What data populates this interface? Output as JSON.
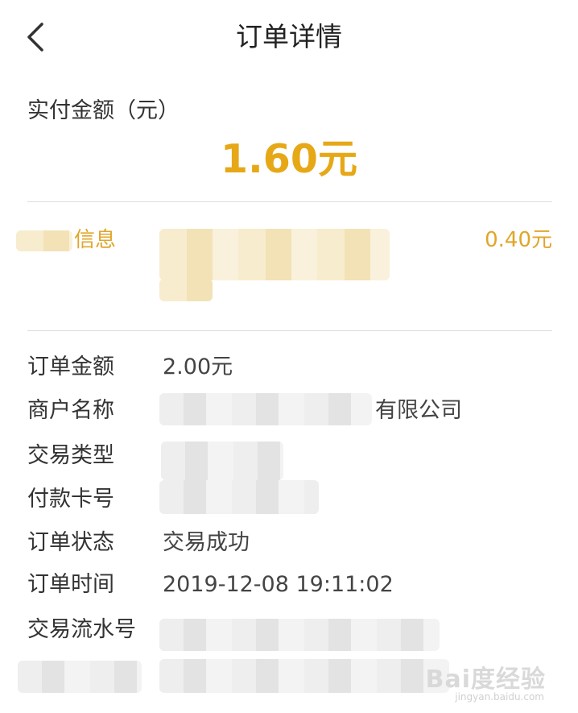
{
  "header": {
    "title": "订单详情"
  },
  "payment": {
    "label": "实付金额（元）",
    "amount": "1.60元"
  },
  "discount": {
    "label": "信息",
    "value": "0.40元"
  },
  "details": {
    "order_amount": {
      "label": "订单金额",
      "value": "2.00元"
    },
    "merchant": {
      "label": "商户名称",
      "value_suffix": "有限公司"
    },
    "trade_type": {
      "label": "交易类型"
    },
    "card_no": {
      "label": "付款卡号"
    },
    "status": {
      "label": "订单状态",
      "value": "交易成功"
    },
    "time": {
      "label": "订单时间",
      "value": "2019-12-08 19:11:02"
    },
    "serial": {
      "label": "交易流水号"
    }
  },
  "watermark": {
    "brand": "Bai度经验",
    "url": "jingyan.baidu.com"
  },
  "colors": {
    "accent": "#e6a817",
    "text": "#333333",
    "divider": "#dcdcdc"
  }
}
